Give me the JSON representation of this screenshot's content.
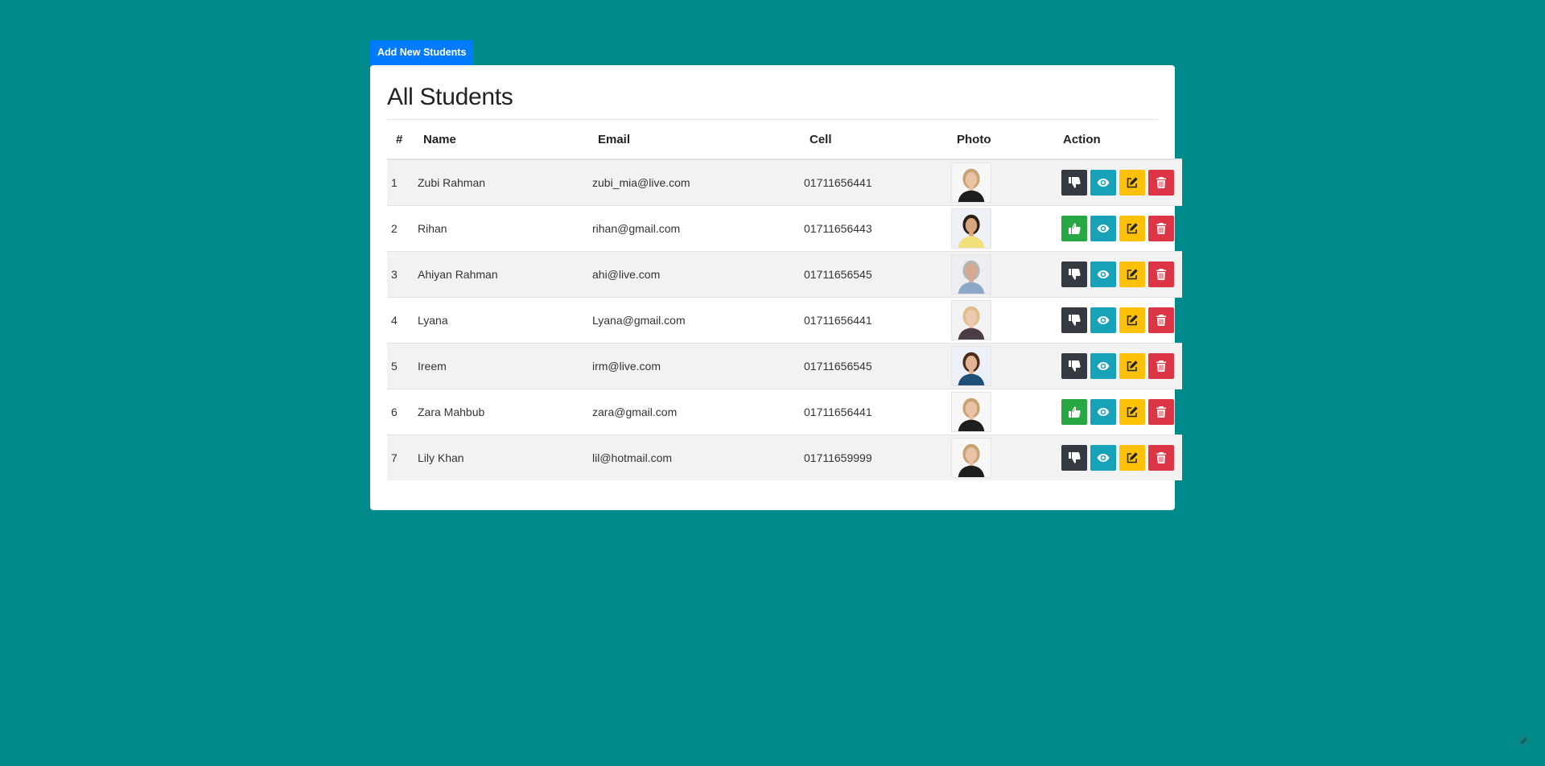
{
  "toolbar": {
    "add_label": "Add New Students"
  },
  "card": {
    "title": "All Students"
  },
  "table": {
    "headers": [
      "#",
      "Name",
      "Email",
      "Cell",
      "Photo",
      "Action"
    ],
    "rows": [
      {
        "num": "1",
        "name": "Zubi Rahman",
        "email": "zubi_mia@live.com",
        "cell": "01711656441",
        "photo": "woman-blonde-portrait",
        "status": "inactive"
      },
      {
        "num": "2",
        "name": "Rihan",
        "email": "rihan@gmail.com",
        "cell": "01711656443",
        "photo": "man-yellow-shirt-portrait",
        "status": "active"
      },
      {
        "num": "3",
        "name": "Ahiyan Rahman",
        "email": "ahi@live.com",
        "cell": "01711656545",
        "photo": "man-tie-portrait",
        "status": "inactive"
      },
      {
        "num": "4",
        "name": "Lyana",
        "email": "Lyana@gmail.com",
        "cell": "01711656441",
        "photo": "woman-blonde-smiling-portrait",
        "status": "inactive"
      },
      {
        "num": "5",
        "name": "Ireem",
        "email": "irm@live.com",
        "cell": "01711656545",
        "photo": "woman-brunette-portrait",
        "status": "inactive"
      },
      {
        "num": "6",
        "name": "Zara Mahbub",
        "email": "zara@gmail.com",
        "cell": "01711656441",
        "photo": "woman-blonde-portrait",
        "status": "active"
      },
      {
        "num": "7",
        "name": "Lily Khan",
        "email": "lil@hotmail.com",
        "cell": "01711659999",
        "photo": "woman-blonde-portrait",
        "status": "inactive"
      }
    ]
  },
  "actions": {
    "active_icon": "thumbs-up-icon",
    "inactive_icon": "thumbs-down-icon",
    "view_icon": "eye-icon",
    "edit_icon": "edit-icon",
    "delete_icon": "trash-icon"
  },
  "colors": {
    "background": "#008b8b",
    "primary": "#007bff",
    "dark": "#343a40",
    "success": "#28a745",
    "info": "#17a2b8",
    "warning": "#ffc107",
    "danger": "#dc3545"
  }
}
